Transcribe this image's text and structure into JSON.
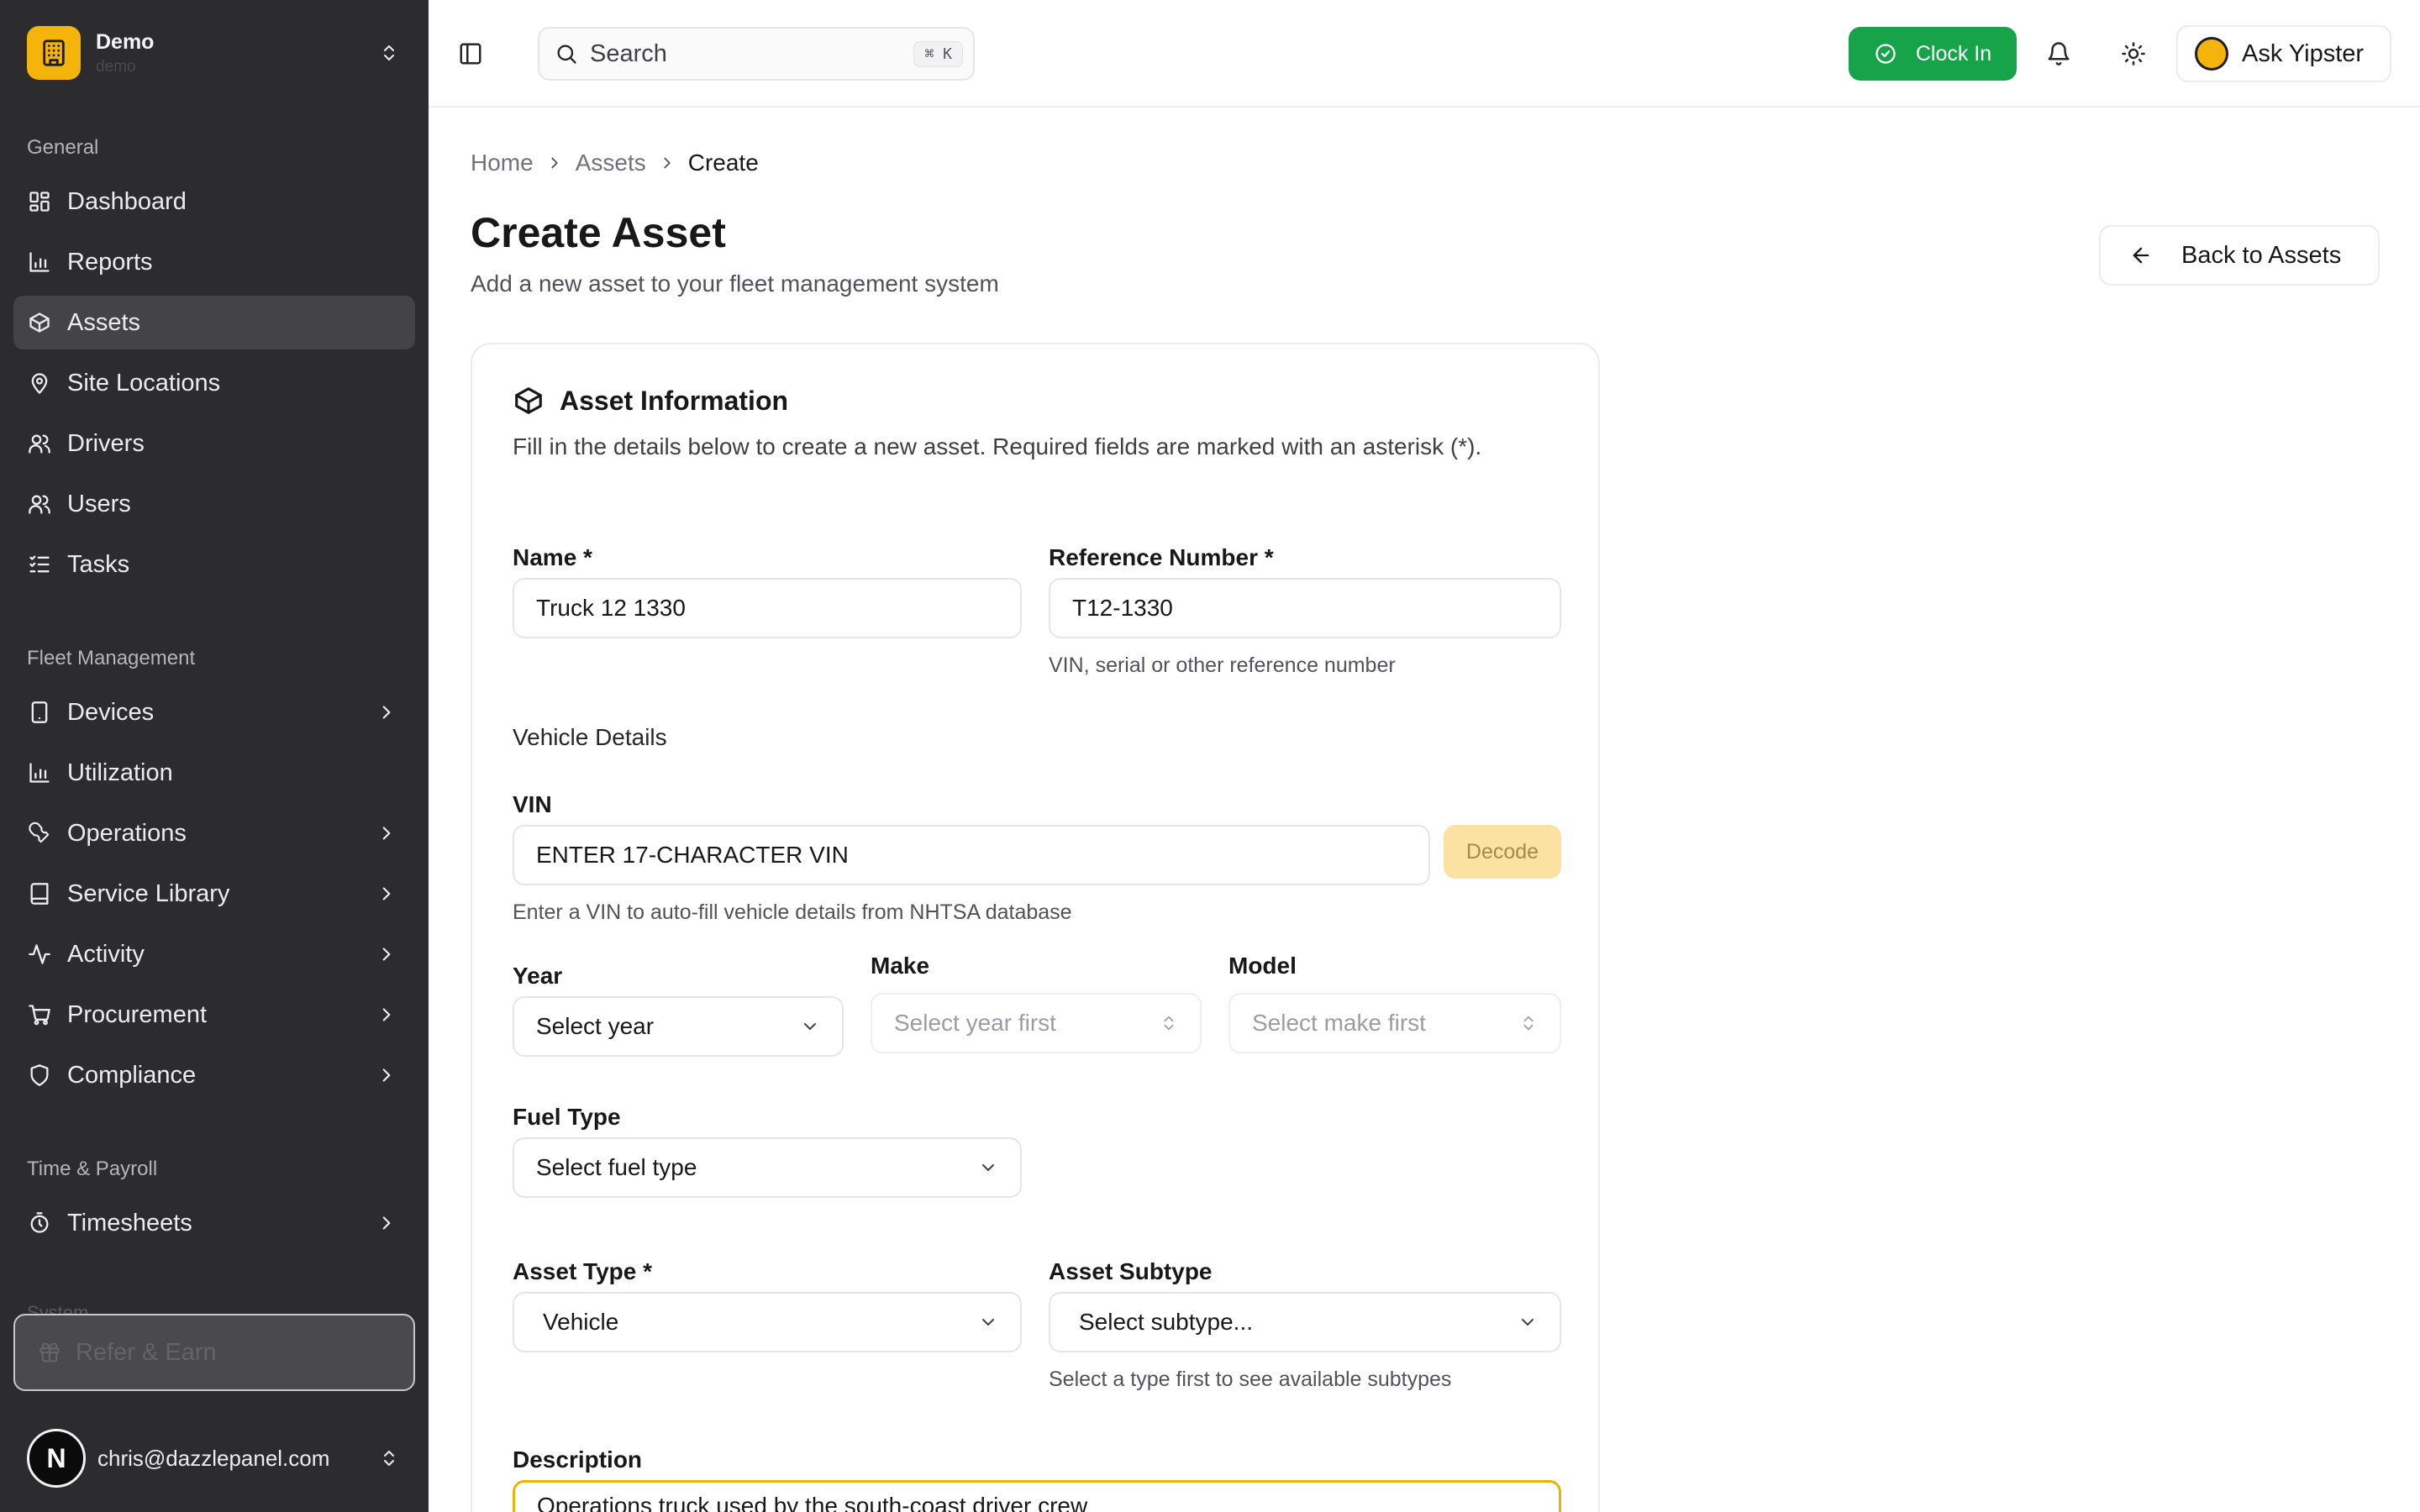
{
  "org": {
    "name": "Demo",
    "subtitle": "demo"
  },
  "sidebar": {
    "sections": {
      "general": "General",
      "fleet": "Fleet Management",
      "time": "Time & Payroll",
      "system_peek": "System"
    },
    "general_items": [
      {
        "label": "Dashboard",
        "icon": "dashboard-icon"
      },
      {
        "label": "Reports",
        "icon": "chart-icon"
      },
      {
        "label": "Assets",
        "icon": "box-icon",
        "active": true
      },
      {
        "label": "Site Locations",
        "icon": "map-pin-icon"
      },
      {
        "label": "Drivers",
        "icon": "users-icon"
      },
      {
        "label": "Users",
        "icon": "user-icon"
      },
      {
        "label": "Tasks",
        "icon": "list-check-icon"
      }
    ],
    "fleet_items": [
      {
        "label": "Devices",
        "icon": "tablet-icon"
      },
      {
        "label": "Utilization",
        "icon": "chart-icon"
      },
      {
        "label": "Operations",
        "icon": "wrench-icon"
      },
      {
        "label": "Service Library",
        "icon": "book-icon"
      },
      {
        "label": "Activity",
        "icon": "activity-icon"
      },
      {
        "label": "Procurement",
        "icon": "cart-icon"
      },
      {
        "label": "Compliance",
        "icon": "shield-icon"
      }
    ],
    "time_items": [
      {
        "label": "Timesheets",
        "icon": "timer-icon"
      }
    ],
    "refer_label": "Refer & Earn",
    "user_email": "chris@dazzlepanel.com",
    "user_initial": "N"
  },
  "topbar": {
    "search_placeholder": "Search",
    "search_shortcut": "⌘ K",
    "clock_in": "Clock In",
    "ask": "Ask Yipster"
  },
  "breadcrumb": {
    "home": "Home",
    "assets": "Assets",
    "current": "Create"
  },
  "page": {
    "title": "Create Asset",
    "subtitle": "Add a new asset to your fleet management system",
    "back_button": "Back to Assets"
  },
  "card": {
    "title": "Asset Information",
    "description": "Fill in the details below to create a new asset. Required fields are marked with an asterisk (*)."
  },
  "form": {
    "name_label": "Name *",
    "name_value": "Truck 12 1330",
    "ref_label": "Reference Number *",
    "ref_value": "T12-1330",
    "ref_hint": "VIN, serial or other reference number",
    "vehicle_details": "Vehicle Details",
    "vin_label": "VIN",
    "vin_placeholder": "ENTER 17-CHARACTER VIN",
    "decode": "Decode",
    "vin_hint": "Enter a VIN to auto-fill vehicle details from NHTSA database",
    "year_label": "Year",
    "year_value": "Select year",
    "make_label": "Make",
    "make_value": "Select year first",
    "model_label": "Model",
    "model_value": "Select make first",
    "fuel_label": "Fuel Type",
    "fuel_value": "Select fuel type",
    "type_label": "Asset Type *",
    "type_value": "Vehicle",
    "subtype_label": "Asset Subtype",
    "subtype_value": "Select subtype...",
    "subtype_hint": "Select a type first to see available subtypes",
    "description_label": "Description",
    "description_value": "Operations truck used by the south-coast driver crew"
  },
  "colors": {
    "accent": "#f5b40b",
    "success": "#16a34a",
    "sidebar_bg": "#2c2c2e"
  }
}
